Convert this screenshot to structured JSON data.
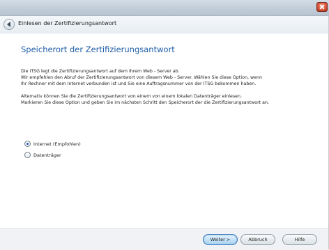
{
  "window": {
    "close_icon": "close-icon"
  },
  "header": {
    "back_icon": "back-arrow-icon",
    "title": "Einlesen der Zertifizierungsantwort"
  },
  "main": {
    "heading": "Speicherort der Zertifizierungsantwort",
    "paragraph1": [
      "Die ITSG legt die Zertifizierungsantwort auf dem ihrem Web - Server ab.",
      "Wir empfehlen den Abruf der Zertifizierungsantwort von diesem Web - Server. Wählen Sie diese Option, wenn",
      "Ihr Rechner mit dem Internet verbunden ist und Sie eine Auftragsnummer von der ITSG bekommen haben."
    ],
    "paragraph2": [
      "Alternativ können Sie die Zertifizierungsantwort von einem von einem lokalen Datenträger einlesen.",
      "Markieren Sie diese Option und geben Sie im nächsten Schritt den Speicherort der die Zertifizierungsantwort an."
    ],
    "options": [
      {
        "label": "Internet (Empfohlen)",
        "selected": true
      },
      {
        "label": "Datenträger",
        "selected": false
      }
    ]
  },
  "footer": {
    "next_label": "Weiter >",
    "cancel_label": "Abbruch",
    "help_label": "Hilfe"
  },
  "colors": {
    "heading": "#1f5da8",
    "primary_button": "#a9d3f1"
  }
}
